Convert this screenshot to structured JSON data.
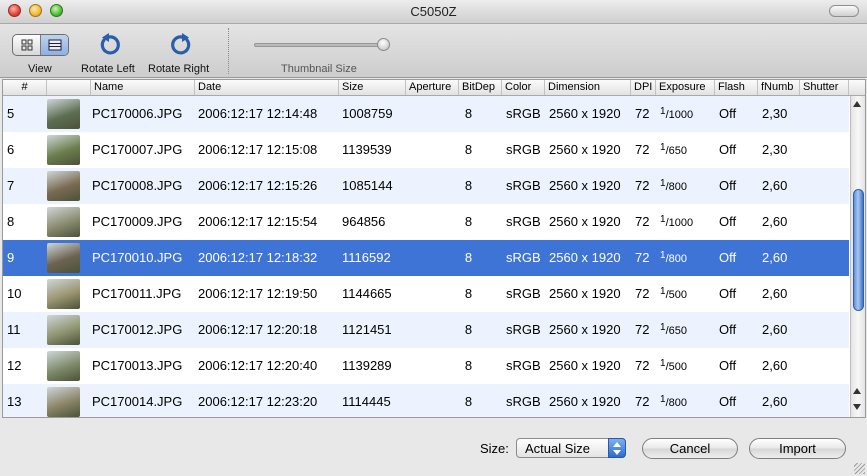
{
  "window": {
    "title": "C5050Z"
  },
  "toolbar": {
    "view_label": "View",
    "rotate_left_label": "Rotate Left",
    "rotate_right_label": "Rotate Right",
    "thumbnail_size_label": "Thumbnail Size",
    "thumbnail_size_value": 1.0
  },
  "table": {
    "columns": [
      "#",
      "",
      "Name",
      "Date",
      "Size",
      "Aperture",
      "BitDep",
      "Color",
      "Dimension",
      "DPI",
      "Exposure",
      "Flash",
      "fNumb",
      "Shutter"
    ],
    "rows": [
      {
        "num": "5",
        "name": "PC170006.JPG",
        "date": "2006:12:17 12:14:48",
        "size": "1008759",
        "bitdep": "8",
        "color": "sRGB",
        "dimension": "2560 x 1920",
        "dpi": "72",
        "exp_num": "1",
        "exp_den": "1000",
        "flash": "Off",
        "fnumb": "2,30",
        "thumb": "#5d6e52"
      },
      {
        "num": "6",
        "name": "PC170007.JPG",
        "date": "2006:12:17 12:15:08",
        "size": "1139539",
        "bitdep": "8",
        "color": "sRGB",
        "dimension": "2560 x 1920",
        "dpi": "72",
        "exp_num": "1",
        "exp_den": "650",
        "flash": "Off",
        "fnumb": "2,30",
        "thumb": "#6b7e4c"
      },
      {
        "num": "7",
        "name": "PC170008.JPG",
        "date": "2006:12:17 12:15:26",
        "size": "1085144",
        "bitdep": "8",
        "color": "sRGB",
        "dimension": "2560 x 1920",
        "dpi": "72",
        "exp_num": "1",
        "exp_den": "800",
        "flash": "Off",
        "fnumb": "2,60",
        "thumb": "#7a6a52"
      },
      {
        "num": "8",
        "name": "PC170009.JPG",
        "date": "2006:12:17 12:15:54",
        "size": "964856",
        "bitdep": "8",
        "color": "sRGB",
        "dimension": "2560 x 1920",
        "dpi": "72",
        "exp_num": "1",
        "exp_den": "1000",
        "flash": "Off",
        "fnumb": "2,60",
        "thumb": "#8a8c70"
      },
      {
        "num": "9",
        "name": "PC170010.JPG",
        "date": "2006:12:17 12:18:32",
        "size": "1116592",
        "bitdep": "8",
        "color": "sRGB",
        "dimension": "2560 x 1920",
        "dpi": "72",
        "exp_num": "1",
        "exp_den": "800",
        "flash": "Off",
        "fnumb": "2,60",
        "thumb": "#6c6352",
        "selected": true
      },
      {
        "num": "10",
        "name": "PC170011.JPG",
        "date": "2006:12:17 12:19:50",
        "size": "1144665",
        "bitdep": "8",
        "color": "sRGB",
        "dimension": "2560 x 1920",
        "dpi": "72",
        "exp_num": "1",
        "exp_den": "500",
        "flash": "Off",
        "fnumb": "2,60",
        "thumb": "#9a9470"
      },
      {
        "num": "11",
        "name": "PC170012.JPG",
        "date": "2006:12:17 12:20:18",
        "size": "1121451",
        "bitdep": "8",
        "color": "sRGB",
        "dimension": "2560 x 1920",
        "dpi": "72",
        "exp_num": "1",
        "exp_den": "650",
        "flash": "Off",
        "fnumb": "2,60",
        "thumb": "#8f9570"
      },
      {
        "num": "12",
        "name": "PC170013.JPG",
        "date": "2006:12:17 12:20:40",
        "size": "1139289",
        "bitdep": "8",
        "color": "sRGB",
        "dimension": "2560 x 1920",
        "dpi": "72",
        "exp_num": "1",
        "exp_den": "500",
        "flash": "Off",
        "fnumb": "2,60",
        "thumb": "#7e8a6a"
      },
      {
        "num": "13",
        "name": "PC170014.JPG",
        "date": "2006:12:17 12:23:20",
        "size": "1114445",
        "bitdep": "8",
        "color": "sRGB",
        "dimension": "2560 x 1920",
        "dpi": "72",
        "exp_num": "1",
        "exp_den": "800",
        "flash": "Off",
        "fnumb": "2,60",
        "thumb": "#8a8566"
      }
    ]
  },
  "bottom": {
    "size_label": "Size:",
    "size_value": "Actual Size",
    "cancel_label": "Cancel",
    "import_label": "Import"
  },
  "colors": {
    "selection": "#3e74d6",
    "stripe": "#edf3fe"
  }
}
